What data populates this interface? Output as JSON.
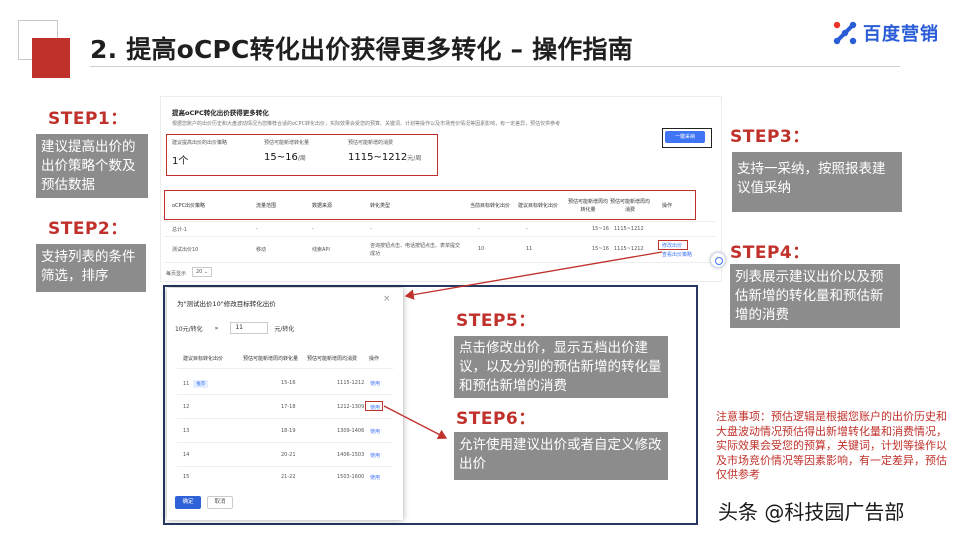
{
  "slide": {
    "title": "2. 提高oCPC转化出价获得更多转化 – 操作指南",
    "logo_text": "百度营销"
  },
  "steps": [
    {
      "label": "STEP1：",
      "desc": "建议提高出价的出价策略个数及预估数据"
    },
    {
      "label": "STEP2：",
      "desc": "支持列表的条件筛选，排序"
    },
    {
      "label": "STEP3：",
      "desc": "支持一采纳，按照报表建议值采纳"
    },
    {
      "label": "STEP4：",
      "desc": "列表展示建议出价以及预估新增的转化量和预估新增的消费"
    },
    {
      "label": "STEP5：",
      "desc": "点击修改出价，显示五档出价建议，以及分别的预估新增的转化量和预估新增的消费"
    },
    {
      "label": "STEP6：",
      "desc": "允许使用建议出价或者自定义修改出价"
    }
  ],
  "panel": {
    "title": "提高oCPC转化出价获得更多转化",
    "desc": "根据您账户的出价历史和大盘波动情况为您推荐合适的oCPC转化出价，实际效果会受您的预算、关键词、计划等操作以及市场竞价情况等因素影响，有一定差异，预估仅供参考",
    "adopt_button": "一键采纳",
    "summary": [
      {
        "label": "建议提高出价的出价策略",
        "value": "1个",
        "unit": ""
      },
      {
        "label": "预估可能新增转化量",
        "value": "15~16",
        "unit": "/周"
      },
      {
        "label": "预估可能新增的消费",
        "value": "1115~1212",
        "unit": "元/周"
      }
    ],
    "columns": [
      "oCPC出价策略",
      "流量范围",
      "数据来源",
      "转化类型",
      "当前目标转化出价",
      "建议目标转化出价",
      "预估可能新增周均转化量",
      "预估可能新增周均消费",
      "操作"
    ],
    "rows": [
      {
        "name": "总计-1",
        "flow": "-",
        "source": "-",
        "type": "-",
        "current": "-",
        "suggest": "-",
        "conv": "15~16",
        "cost": "1115~1212",
        "action": "",
        "action2": ""
      },
      {
        "name": "测试出价10",
        "flow": "移动",
        "source": "线索API",
        "type": "咨询按钮点击、电话按钮点击、表单提交成功",
        "current": "10",
        "suggest": "11",
        "conv": "15~16",
        "cost": "1115~1212",
        "action": "修改出价",
        "action2": "查看出价策略"
      }
    ],
    "pager_label": "每页显示",
    "pager_value": "20"
  },
  "modal": {
    "title": "为\"测试出价10\"修改目标转化出价",
    "current_value": "10元/转化",
    "arrow": "»",
    "input_value": "11",
    "input_unit": "元/转化",
    "columns": [
      "建议目标转化出价",
      "预估可能新增周均转化量",
      "预估可能新增周均消费",
      "操作"
    ],
    "rows": [
      {
        "bid": "11",
        "tag": "推荐",
        "conv": "15-16",
        "cost": "1115-1212",
        "action": "使用"
      },
      {
        "bid": "12",
        "tag": "",
        "conv": "17-18",
        "cost": "1212-1309",
        "action": "使用"
      },
      {
        "bid": "13",
        "tag": "",
        "conv": "18-19",
        "cost": "1309-1406",
        "action": "使用"
      },
      {
        "bid": "14",
        "tag": "",
        "conv": "20-21",
        "cost": "1406-1503",
        "action": "使用"
      },
      {
        "bid": "15",
        "tag": "",
        "conv": "21-22",
        "cost": "1503-1600",
        "action": "使用"
      }
    ],
    "ok_button": "确定",
    "cancel_button": "取消"
  },
  "note": "注意事项：预估逻辑是根据您账户的出价历史和大盘波动情况预估得出新增转化量和消费情况，实际效果会受您的预算，关键词，计划等操作以及市场竞价情况等因素影响，有一定差异，预估仅供参考",
  "watermark": "头条 @科技园广告部",
  "colors": {
    "accent_red": "#c0312b",
    "brand_blue": "#2a5cd8",
    "step_gray": "#8c8c8c",
    "frame_navy": "#27375f"
  }
}
